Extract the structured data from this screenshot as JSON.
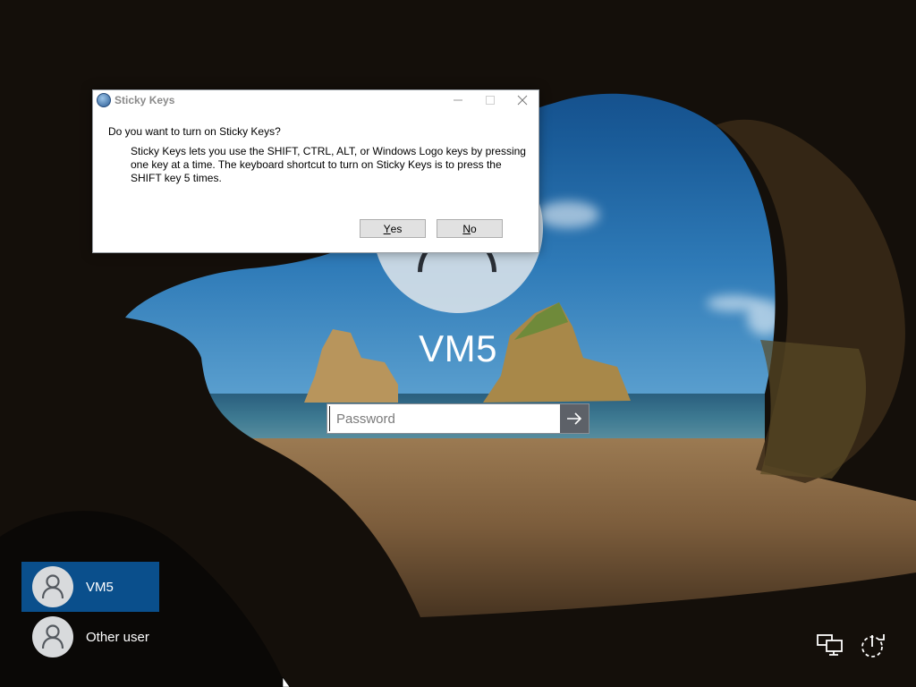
{
  "dialog": {
    "title": "Sticky Keys",
    "question": "Do you want to turn on Sticky Keys?",
    "body": "Sticky Keys lets you use the SHIFT, CTRL, ALT, or Windows Logo keys by pressing one key at a time. The keyboard shortcut to turn on Sticky Keys is to press the SHIFT key 5 times.",
    "yes_hotkey": "Y",
    "yes_rest": "es",
    "no_hotkey": "N",
    "no_rest": "o"
  },
  "login": {
    "user_name": "VM5",
    "password_placeholder": "Password"
  },
  "user_list": [
    {
      "label": "VM5",
      "selected": true
    },
    {
      "label": "Other user",
      "selected": false
    }
  ],
  "icons": {
    "dialog_app": "sticky-keys-icon",
    "submit": "arrow-right-icon",
    "network": "network-icon",
    "power": "power-icon",
    "user": "user-icon"
  },
  "colors": {
    "selected_user_bg": "#0a4f8c",
    "submit_bg": "#5d6168"
  }
}
